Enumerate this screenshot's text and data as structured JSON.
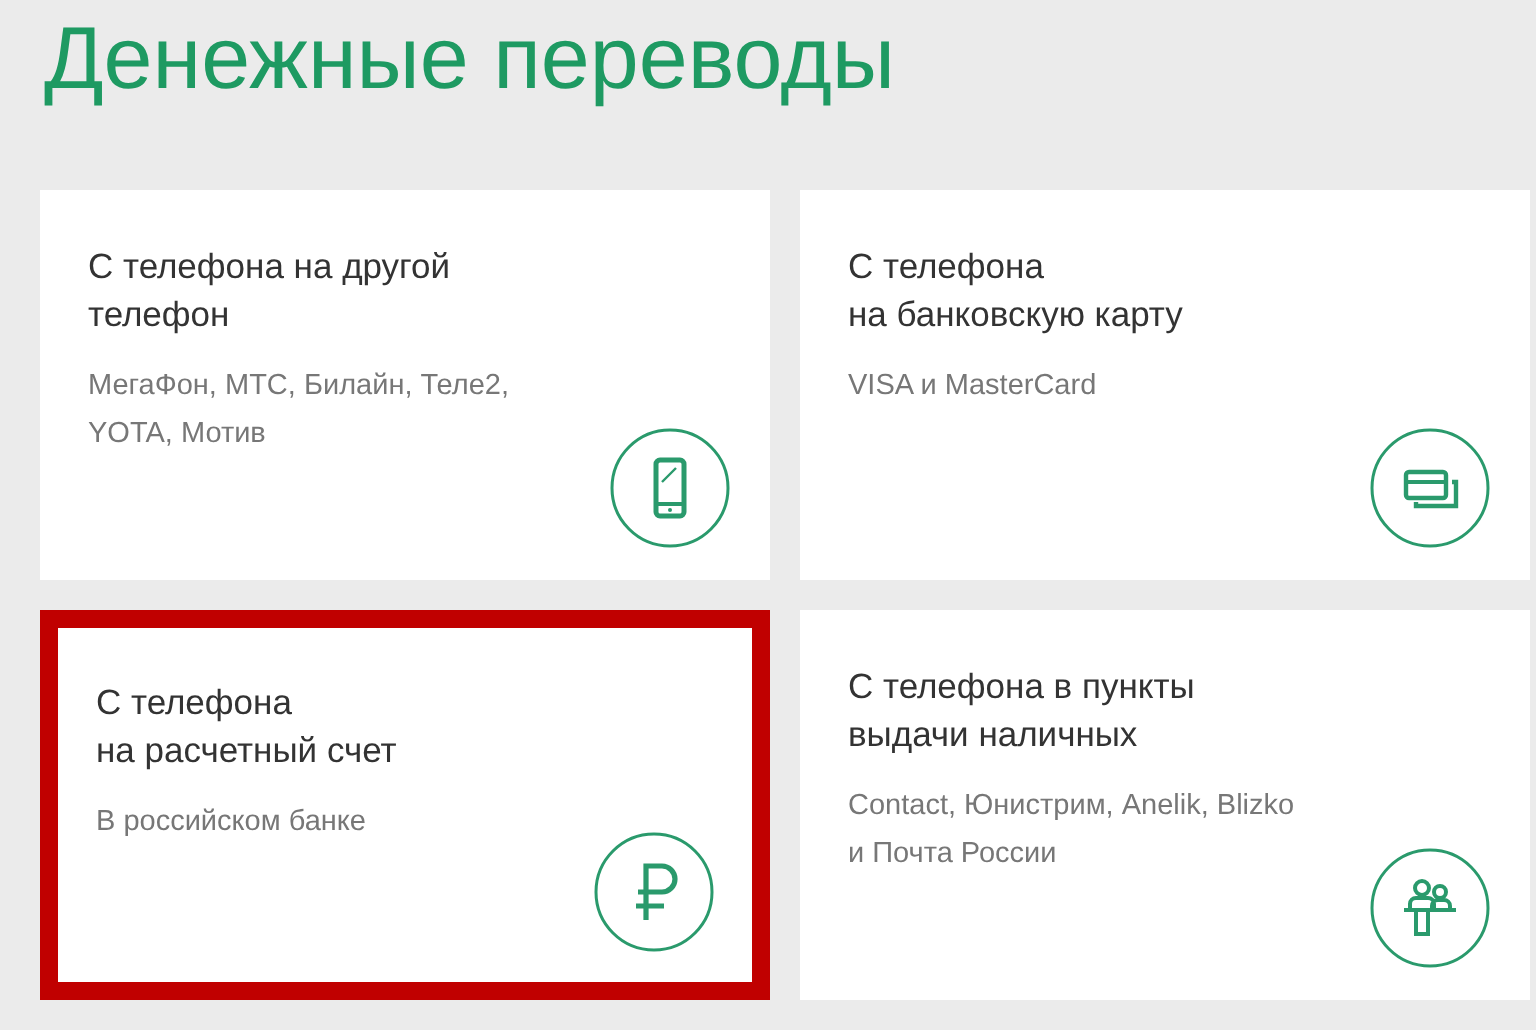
{
  "title": "Денежные переводы",
  "cards": [
    {
      "title_lines": [
        "С телефона на другой",
        "телефон"
      ],
      "subtitle_lines": [
        "МегаФон, МТС, Билайн, Теле2,",
        "YOTA, Мотив"
      ],
      "kind": "phone",
      "highlighted": false
    },
    {
      "title_lines": [
        "С телефона",
        "на банковскую карту"
      ],
      "subtitle_lines": [
        "VISA и MasterCard"
      ],
      "kind": "cards",
      "highlighted": false
    },
    {
      "title_lines": [
        "С телефона",
        "на расчетный счет"
      ],
      "subtitle_lines": [
        "В российском банке"
      ],
      "kind": "ruble",
      "highlighted": true
    },
    {
      "title_lines": [
        "С телефона в пункты",
        "выдачи наличных"
      ],
      "subtitle_lines": [
        "Contact, Юнистрим, Anelik, Blizko",
        "и Почта России"
      ],
      "kind": "people",
      "highlighted": false
    }
  ]
}
